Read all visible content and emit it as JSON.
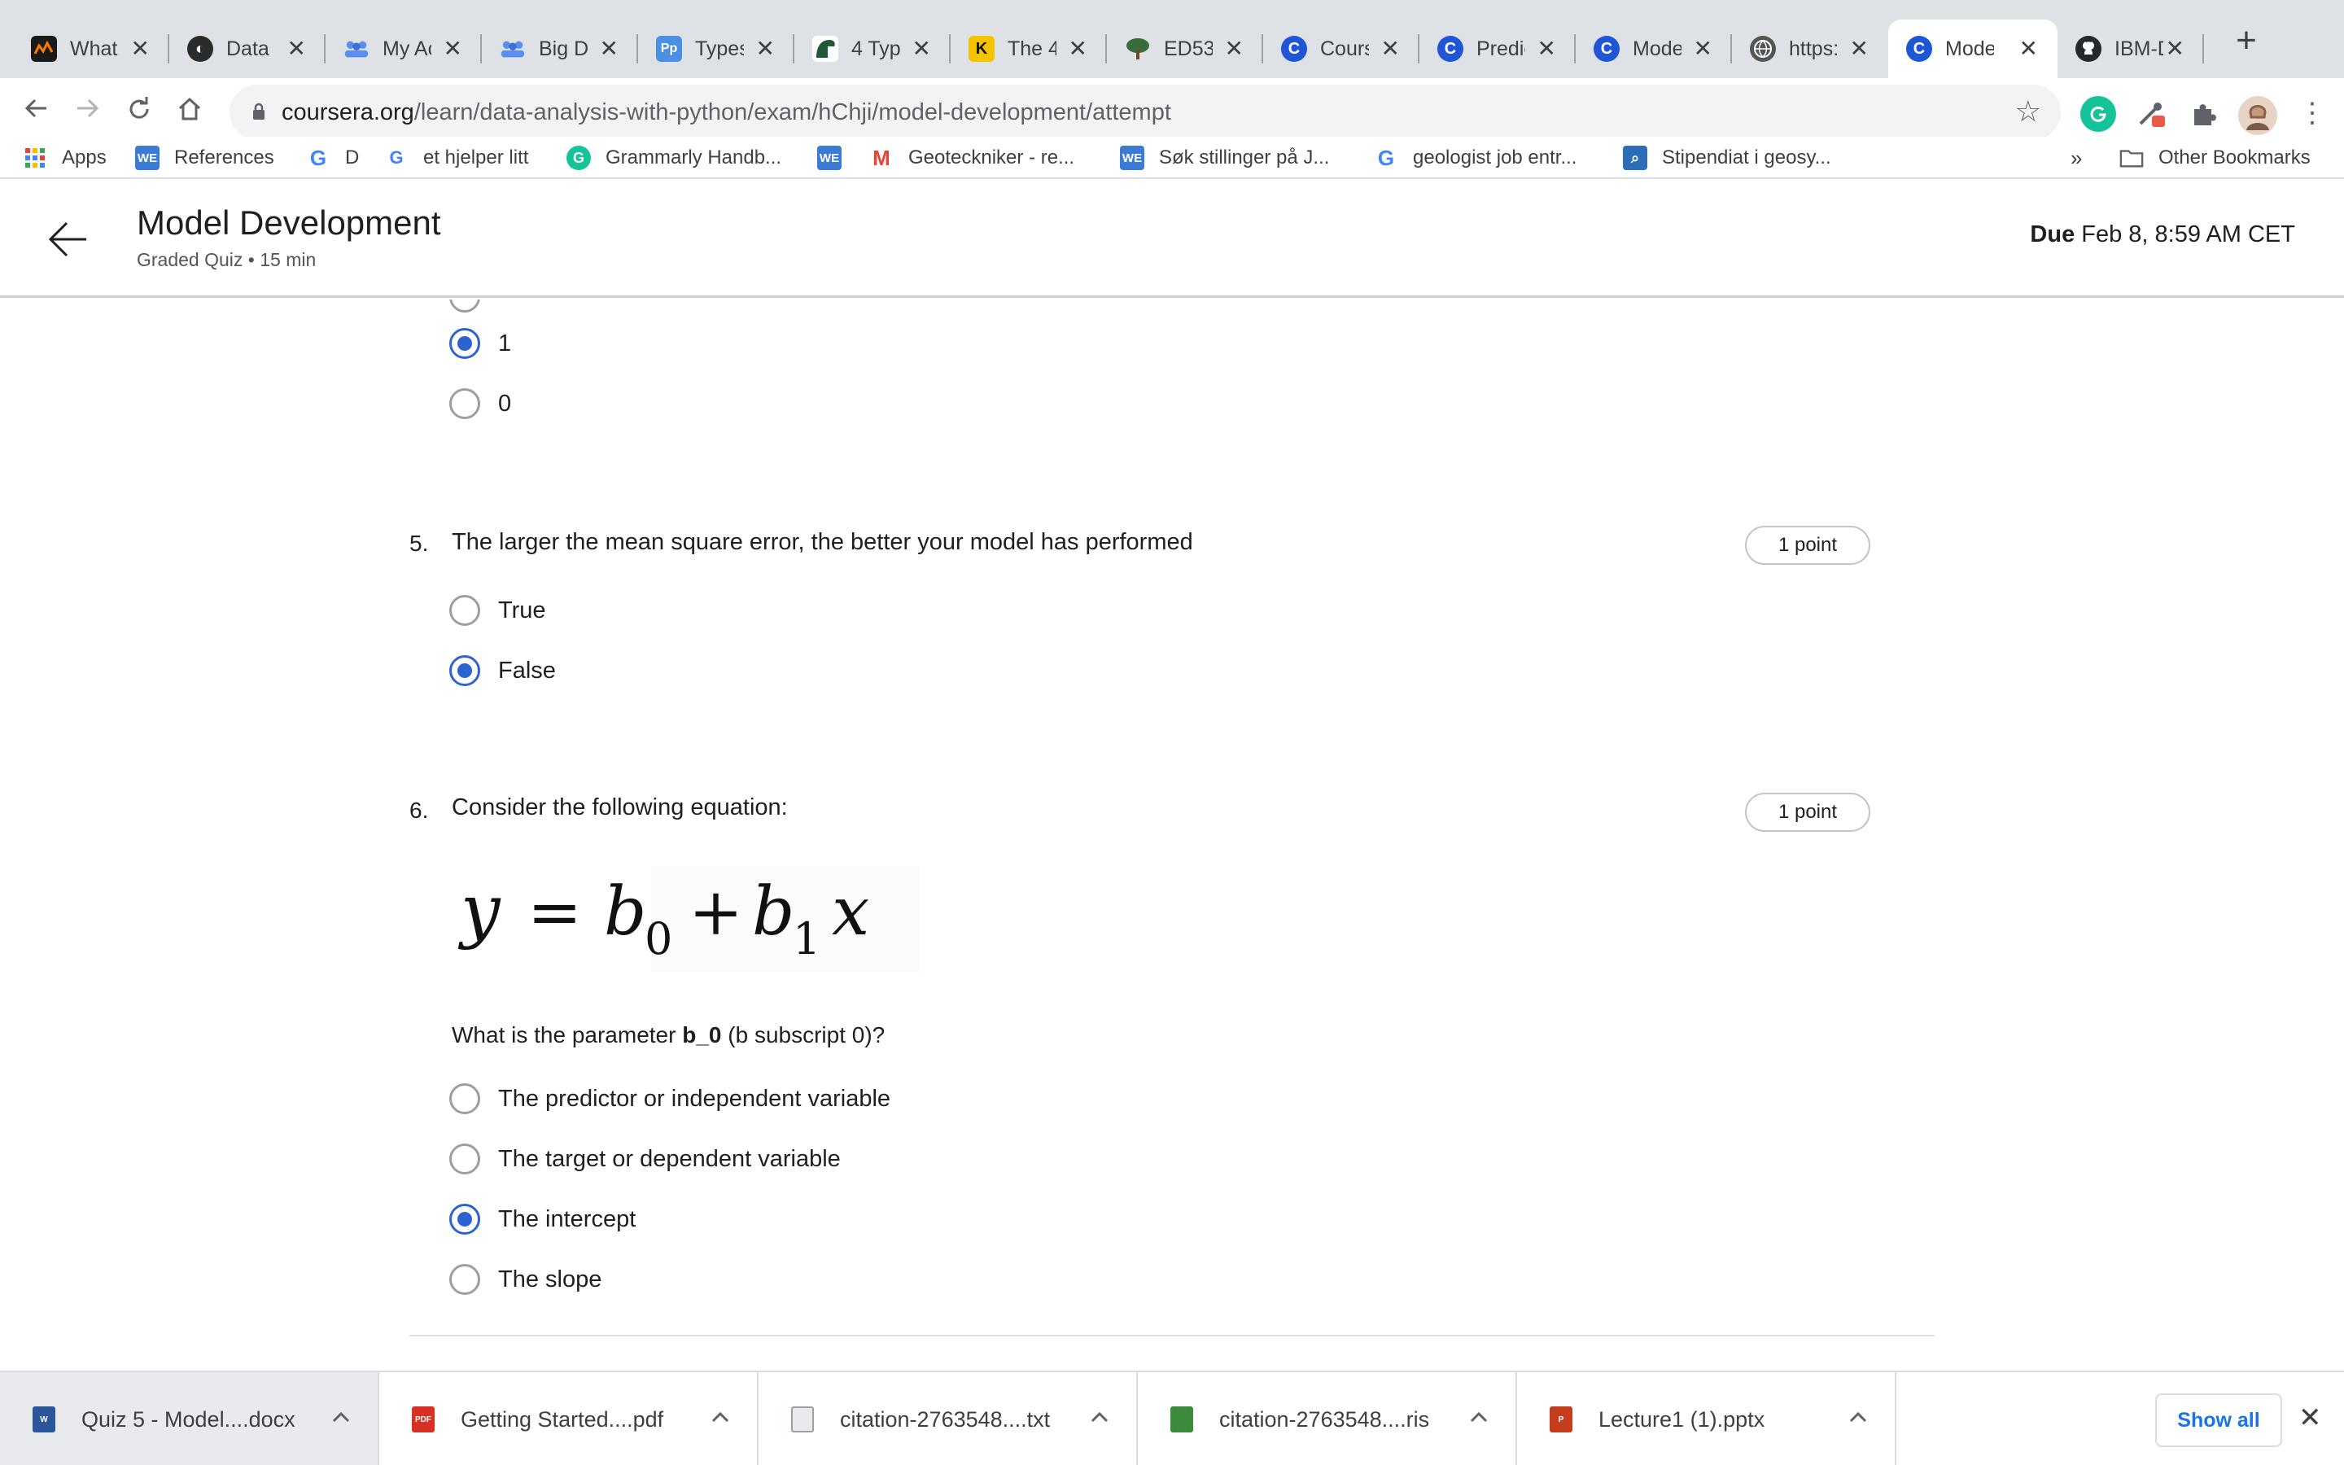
{
  "browser": {
    "tabs": [
      {
        "title": "What",
        "favicon_color": "#1a1a1a",
        "favicon_glyph": "~"
      },
      {
        "title": "Data",
        "favicon_color": "#2b2b2b",
        "favicon_glyph": "D"
      },
      {
        "title": "My Ac",
        "favicon_color": "#5b8def",
        "favicon_glyph": "👥"
      },
      {
        "title": "Big D",
        "favicon_color": "#5b8def",
        "favicon_glyph": "👥"
      },
      {
        "title": "Types",
        "favicon_color": "#4a90e2",
        "favicon_glyph": "Pp"
      },
      {
        "title": "4 Typ",
        "favicon_color": "#1e5a3a",
        "favicon_glyph": "⛵"
      },
      {
        "title": "The 4",
        "favicon_color": "#f5c400",
        "favicon_glyph": "K"
      },
      {
        "title": "ED53",
        "favicon_color": "#3a6b3a",
        "favicon_glyph": "🌳"
      },
      {
        "title": "Cours",
        "favicon_color": "#1f56d6",
        "favicon_glyph": "C"
      },
      {
        "title": "Predic",
        "favicon_color": "#1f56d6",
        "favicon_glyph": "C"
      },
      {
        "title": "Mode",
        "favicon_color": "#1f56d6",
        "favicon_glyph": "C"
      },
      {
        "title": "https:",
        "favicon_color": "#555555",
        "favicon_glyph": "◍"
      },
      {
        "title": "Mode",
        "favicon_color": "#1f56d6",
        "favicon_glyph": "C",
        "active": true
      },
      {
        "title": "IBM-D",
        "favicon_color": "#24292e",
        "favicon_glyph": "●"
      }
    ],
    "new_tab_label": "+",
    "close_glyph": "✕",
    "url_host": "coursera.org",
    "url_path": "/learn/data-analysis-with-python/exam/hChji/model-development/attempt",
    "bookmarks": [
      {
        "label": "Apps",
        "icon": "apps-grid-icon",
        "color": "#e94235"
      },
      {
        "label": "References",
        "icon": "WE",
        "color": "#3b7bd4"
      },
      {
        "label": "D",
        "icon": "G",
        "color": "#4285f4"
      },
      {
        "label": "et hjelper litt",
        "icon": "G",
        "color": "#4285f4"
      },
      {
        "label": "Grammarly Handb...",
        "icon": "G",
        "color": "#15c39a"
      },
      {
        "label": "",
        "icon": "WE",
        "color": "#3b7bd4"
      },
      {
        "label": "Geoteckniker - re...",
        "icon": "M",
        "color": "#ea4335"
      },
      {
        "label": "Søk stillinger på J...",
        "icon": "WE",
        "color": "#3b7bd4"
      },
      {
        "label": "geologist job entr...",
        "icon": "G",
        "color": "#4285f4"
      },
      {
        "label": "Stipendiat i geosy...",
        "icon": "⌕",
        "color": "#2d6db5"
      }
    ],
    "bookmarks_overflow": "»",
    "other_bookmarks_label": "Other Bookmarks"
  },
  "course": {
    "title": "Model Development",
    "subtitle": "Graded Quiz • 15 min",
    "due_label": "Due",
    "due_value": "Feb 8, 8:59 AM CET"
  },
  "quiz": {
    "prev_options": [
      {
        "label": "1",
        "selected": true
      },
      {
        "label": "0",
        "selected": false
      }
    ],
    "questions": [
      {
        "number": "5.",
        "text": "The larger the mean square error, the better your model has performed",
        "points": "1 point",
        "options": [
          {
            "label": "True",
            "selected": false
          },
          {
            "label": "False",
            "selected": true
          }
        ]
      },
      {
        "number": "6.",
        "text": "Consider the following equation:",
        "points": "1 point",
        "equation": {
          "lhs": "y",
          "eq": "=",
          "b": "b",
          "sub0": "0",
          "plus": "+",
          "sub1": "1",
          "x": "x"
        },
        "sub_text_pre": "What is the parameter ",
        "sub_text_bold": "b_0",
        "sub_text_post": " (b subscript 0)?",
        "options": [
          {
            "label": "The predictor or independent variable",
            "selected": false
          },
          {
            "label": "The target or dependent variable",
            "selected": false
          },
          {
            "label": "The intercept",
            "selected": true
          },
          {
            "label": "The slope",
            "selected": false
          }
        ]
      }
    ]
  },
  "downloads": {
    "items": [
      {
        "name": "Quiz 5 - Model....docx",
        "icon": "word-doc-icon",
        "color": "#2b579a",
        "active": true
      },
      {
        "name": "Getting Started....pdf",
        "icon": "pdf-icon",
        "color": "#d93025",
        "icon_text": "PDF"
      },
      {
        "name": "citation-2763548....txt",
        "icon": "text-file-icon",
        "color": "#9aa0a6"
      },
      {
        "name": "citation-2763548....ris",
        "icon": "ris-file-icon",
        "color": "#3c8a3c"
      },
      {
        "name": "Lecture1 (1).pptx",
        "icon": "powerpoint-icon",
        "color": "#c43e1c"
      }
    ],
    "show_all_label": "Show all",
    "close_glyph": "✕"
  }
}
